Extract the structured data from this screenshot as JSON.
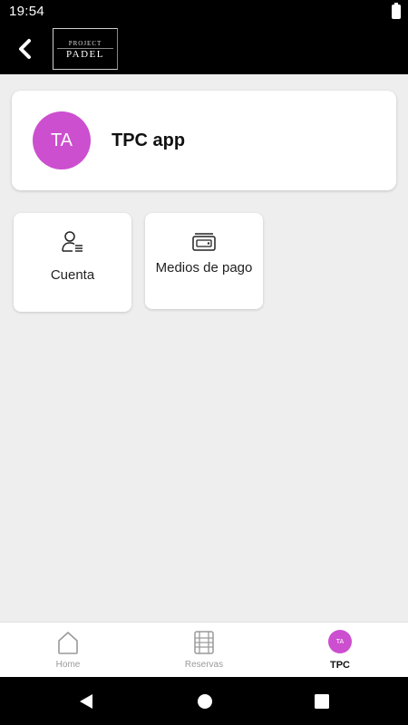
{
  "status_bar": {
    "time": "19:54"
  },
  "app_bar": {
    "logo_top": "PROJECT",
    "logo_bottom": "PADEL"
  },
  "profile": {
    "initials": "TA",
    "name": "TPC app"
  },
  "tiles": [
    {
      "label": "Cuenta",
      "icon": "user-list-icon"
    },
    {
      "label": "Medios de pago",
      "icon": "wallet-card-icon"
    }
  ],
  "bottom_nav": [
    {
      "label": "Home",
      "icon": "home-icon",
      "active": false
    },
    {
      "label": "Reservas",
      "icon": "film-calendar-icon",
      "active": false
    },
    {
      "label": "TPC",
      "icon": "avatar",
      "initials": "TA",
      "active": true
    }
  ],
  "colors": {
    "accent_avatar": "#cc4fcf",
    "app_bar": "#000000",
    "background": "#eeeeee",
    "inactive_nav": "#9a9a9a"
  }
}
